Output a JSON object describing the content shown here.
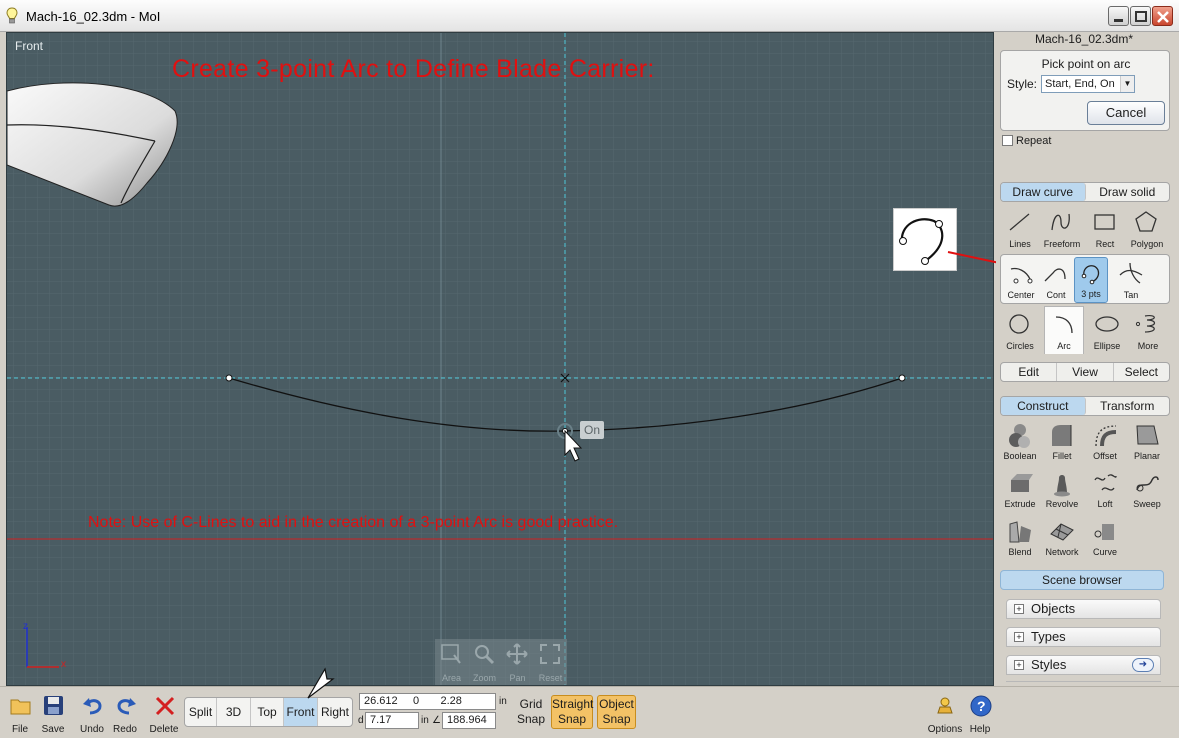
{
  "window": {
    "title": "Mach-16_02.3dm - MoI"
  },
  "viewport": {
    "label": "Front",
    "headline": "Create 3-point Arc to Define Blade Carrier:",
    "note": "Note: Use of C-Lines to aid in the creation of a 3-point Arc is good practice.",
    "snap_tag": "On",
    "nav": [
      {
        "label": "Area",
        "icon": "area-zoom-icon"
      },
      {
        "label": "Zoom",
        "icon": "magnifier-icon"
      },
      {
        "label": "Pan",
        "icon": "pan-arrows-icon"
      },
      {
        "label": "Reset",
        "icon": "reset-view-icon"
      }
    ],
    "axis": {
      "z": "z",
      "x": "x"
    },
    "colors": {
      "background": "#4a5c63",
      "annotation": "#e01010"
    }
  },
  "panel": {
    "filename": "Mach-16_02.3dm*",
    "prompt": "Pick point on arc",
    "style_label": "Style:",
    "style_value": "Start, End, On",
    "cancel": "Cancel",
    "repeat": "Repeat",
    "draw_tabs": [
      "Draw curve",
      "Draw solid"
    ],
    "curve_tools": [
      {
        "label": "Lines",
        "icon": "line-icon"
      },
      {
        "label": "Freeform",
        "icon": "freeform-curve-icon"
      },
      {
        "label": "Rect",
        "icon": "rectangle-icon"
      },
      {
        "label": "Polygon",
        "icon": "polygon-icon"
      }
    ],
    "arc_tools": [
      {
        "label": "Center",
        "icon": "arc-center-icon"
      },
      {
        "label": "Cont",
        "icon": "arc-continue-icon"
      },
      {
        "label": "3 pts",
        "icon": "arc-3pts-icon"
      },
      {
        "label": "Tan",
        "icon": "arc-tangent-icon"
      }
    ],
    "shape_tools": [
      {
        "label": "Circles",
        "icon": "circle-icon"
      },
      {
        "label": "Arc",
        "icon": "arc-icon"
      },
      {
        "label": "Ellipse",
        "icon": "ellipse-icon"
      },
      {
        "label": "More",
        "icon": "spiral-icon"
      }
    ],
    "mode_tabs": [
      "Edit",
      "View",
      "Select"
    ],
    "construct_tabs": [
      "Construct",
      "Transform"
    ],
    "construct_tools": [
      {
        "label": "Boolean",
        "icon": "boolean-icon"
      },
      {
        "label": "Fillet",
        "icon": "fillet-icon"
      },
      {
        "label": "Offset",
        "icon": "offset-icon"
      },
      {
        "label": "Planar",
        "icon": "planar-icon"
      },
      {
        "label": "Extrude",
        "icon": "extrude-icon"
      },
      {
        "label": "Revolve",
        "icon": "revolve-icon"
      },
      {
        "label": "Loft",
        "icon": "loft-icon"
      },
      {
        "label": "Sweep",
        "icon": "sweep-icon"
      },
      {
        "label": "Blend",
        "icon": "blend-icon"
      },
      {
        "label": "Network",
        "icon": "network-icon"
      },
      {
        "label": "Curve",
        "icon": "curve-from-icon"
      }
    ],
    "scene_browser": "Scene browser",
    "accordions": [
      "Objects",
      "Types",
      "Styles"
    ]
  },
  "bottom": {
    "file": "File",
    "save": "Save",
    "undo": "Undo",
    "redo": "Redo",
    "delete": "Delete",
    "views": [
      "Split",
      "3D",
      "Top",
      "Front",
      "Right"
    ],
    "active_view": "Front",
    "coords": {
      "x": "26.612",
      "y": "0",
      "z": "2.28",
      "unit": "in",
      "d_label": "d",
      "d": "7.17",
      "d_unit": "in",
      "angle_label": "∠",
      "angle": "188.964"
    },
    "grid_snap": "Grid Snap",
    "straight_snap": "Straight Snap",
    "object_snap": "Object Snap",
    "options": "Options",
    "help": "Help",
    "snap_color": "#f3c266"
  }
}
